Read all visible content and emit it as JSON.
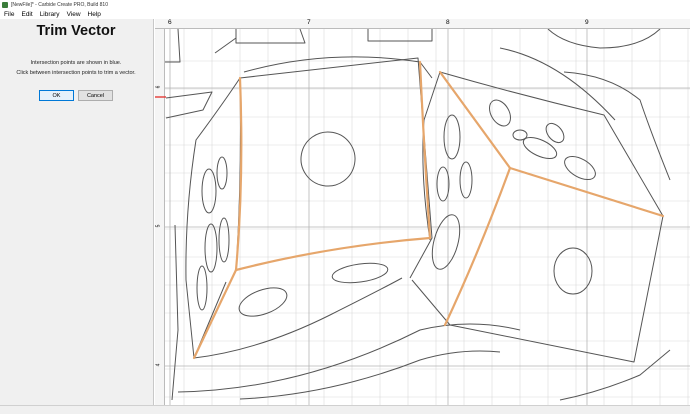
{
  "window": {
    "title": "[NewFile]* - Carbide Create PRO, Build 810"
  },
  "menu": {
    "items": [
      "File",
      "Edit",
      "Library",
      "View",
      "Help"
    ]
  },
  "panel": {
    "title": "Trim Vector",
    "instruction_1": "Intersection points are shown in blue.",
    "instruction_2": "Click between intersection points to trim a vector.",
    "ok_label": "OK",
    "cancel_label": "Cancel"
  },
  "rulers": {
    "top": [
      "6",
      "7",
      "8",
      "9"
    ],
    "left": [
      "6",
      "5",
      "4"
    ]
  },
  "colors": {
    "trim_highlight": "#e6a66b",
    "vector_stroke": "#555555",
    "grid": "#d6d6d6",
    "ok_button_border": "#0078d7"
  }
}
